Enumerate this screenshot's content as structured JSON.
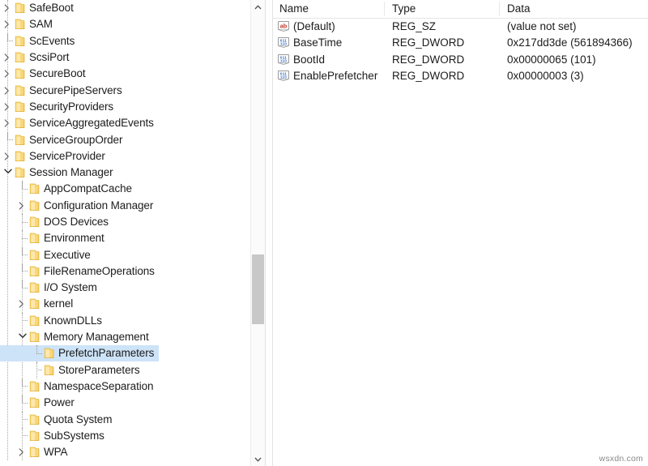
{
  "app": {
    "name": "Registry Editor",
    "watermark": "wsxdn.com"
  },
  "tree": {
    "scrollbar": {
      "up_arrow_icon": "chevron-up-icon",
      "down_arrow_icon": "chevron-down-icon"
    },
    "items": [
      {
        "label": "SafeBoot",
        "depth": 1,
        "state": "collapsed",
        "selected": false
      },
      {
        "label": "SAM",
        "depth": 1,
        "state": "collapsed",
        "selected": false
      },
      {
        "label": "ScEvents",
        "depth": 1,
        "state": "leaf",
        "selected": false
      },
      {
        "label": "ScsiPort",
        "depth": 1,
        "state": "collapsed",
        "selected": false
      },
      {
        "label": "SecureBoot",
        "depth": 1,
        "state": "collapsed",
        "selected": false
      },
      {
        "label": "SecurePipeServers",
        "depth": 1,
        "state": "collapsed",
        "selected": false
      },
      {
        "label": "SecurityProviders",
        "depth": 1,
        "state": "collapsed",
        "selected": false
      },
      {
        "label": "ServiceAggregatedEvents",
        "depth": 1,
        "state": "collapsed",
        "selected": false
      },
      {
        "label": "ServiceGroupOrder",
        "depth": 1,
        "state": "leaf",
        "selected": false
      },
      {
        "label": "ServiceProvider",
        "depth": 1,
        "state": "collapsed",
        "selected": false
      },
      {
        "label": "Session Manager",
        "depth": 1,
        "state": "expanded",
        "selected": false
      },
      {
        "label": "AppCompatCache",
        "depth": 2,
        "state": "leaf",
        "selected": false
      },
      {
        "label": "Configuration Manager",
        "depth": 2,
        "state": "collapsed",
        "selected": false
      },
      {
        "label": "DOS Devices",
        "depth": 2,
        "state": "leaf",
        "selected": false
      },
      {
        "label": "Environment",
        "depth": 2,
        "state": "leaf",
        "selected": false
      },
      {
        "label": "Executive",
        "depth": 2,
        "state": "leaf",
        "selected": false
      },
      {
        "label": "FileRenameOperations",
        "depth": 2,
        "state": "leaf",
        "selected": false
      },
      {
        "label": "I/O System",
        "depth": 2,
        "state": "leaf",
        "selected": false
      },
      {
        "label": "kernel",
        "depth": 2,
        "state": "collapsed",
        "selected": false
      },
      {
        "label": "KnownDLLs",
        "depth": 2,
        "state": "leaf",
        "selected": false
      },
      {
        "label": "Memory Management",
        "depth": 2,
        "state": "expanded",
        "selected": false
      },
      {
        "label": "PrefetchParameters",
        "depth": 3,
        "state": "leaf",
        "selected": true
      },
      {
        "label": "StoreParameters",
        "depth": 3,
        "state": "leaf",
        "selected": false
      },
      {
        "label": "NamespaceSeparation",
        "depth": 2,
        "state": "leaf",
        "selected": false
      },
      {
        "label": "Power",
        "depth": 2,
        "state": "leaf",
        "selected": false
      },
      {
        "label": "Quota System",
        "depth": 2,
        "state": "leaf",
        "selected": false
      },
      {
        "label": "SubSystems",
        "depth": 2,
        "state": "leaf",
        "selected": false
      },
      {
        "label": "WPA",
        "depth": 2,
        "state": "collapsed",
        "selected": false
      }
    ]
  },
  "values": {
    "columns": [
      {
        "key": "name",
        "label": "Name"
      },
      {
        "key": "type",
        "label": "Type"
      },
      {
        "key": "data",
        "label": "Data"
      }
    ],
    "rows": [
      {
        "icon": "string-value-icon",
        "name": "(Default)",
        "type": "REG_SZ",
        "data": "(value not set)"
      },
      {
        "icon": "dword-value-icon",
        "name": "BaseTime",
        "type": "REG_DWORD",
        "data": "0x217dd3de (561894366)"
      },
      {
        "icon": "dword-value-icon",
        "name": "BootId",
        "type": "REG_DWORD",
        "data": "0x00000065 (101)"
      },
      {
        "icon": "dword-value-icon",
        "name": "EnablePrefetcher",
        "type": "REG_DWORD",
        "data": "0x00000003 (3)"
      }
    ]
  },
  "colors": {
    "selection": "#cde3f7",
    "folder": "#fbd779",
    "string_icon": "#c0392b",
    "dword_icon": "#2a63c4",
    "text": "#1b1b1b",
    "scroll_thumb": "#c8c8c8"
  }
}
